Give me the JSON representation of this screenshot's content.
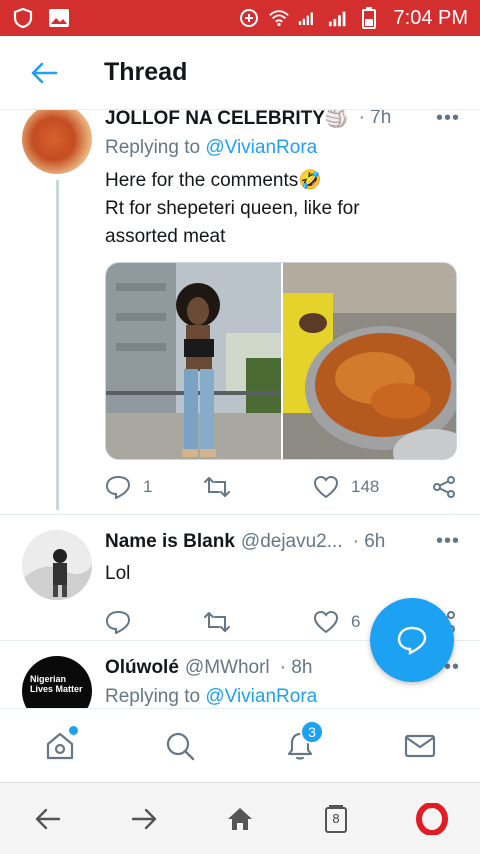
{
  "status_bar": {
    "time": "7:04 PM"
  },
  "header": {
    "title": "Thread"
  },
  "tweets": [
    {
      "name": "JOLLOF NA CELEBRITY🏐",
      "time": "· 7h",
      "more": "•••",
      "reply_prefix": "Replying to",
      "reply_to": "@VivianRora",
      "text_line1": "Here for the comments🤣",
      "text_line2": "Rt for shepeteri queen, like for",
      "text_line3": "assorted meat",
      "replies": "1",
      "retweets": "",
      "likes": "148"
    },
    {
      "name": "Name is Blank",
      "handle": "@dejavu2...",
      "time": "· 6h",
      "more": "•••",
      "text": "Lol",
      "likes": "6"
    },
    {
      "name": "Olúwolé",
      "handle": "@MWhorl",
      "time": "· 8h",
      "more": "•••",
      "reply_prefix": "Replying to",
      "reply_to": "@VivianRora",
      "avatar_text": "Nigerian Lives Matter"
    }
  ],
  "bottom_nav": {
    "notifications_badge": "3"
  },
  "browser": {
    "tabs_count": "8"
  },
  "colors": {
    "accent": "#1da1f2",
    "status_bar": "#d32f2f",
    "opera": "#e31b23"
  }
}
